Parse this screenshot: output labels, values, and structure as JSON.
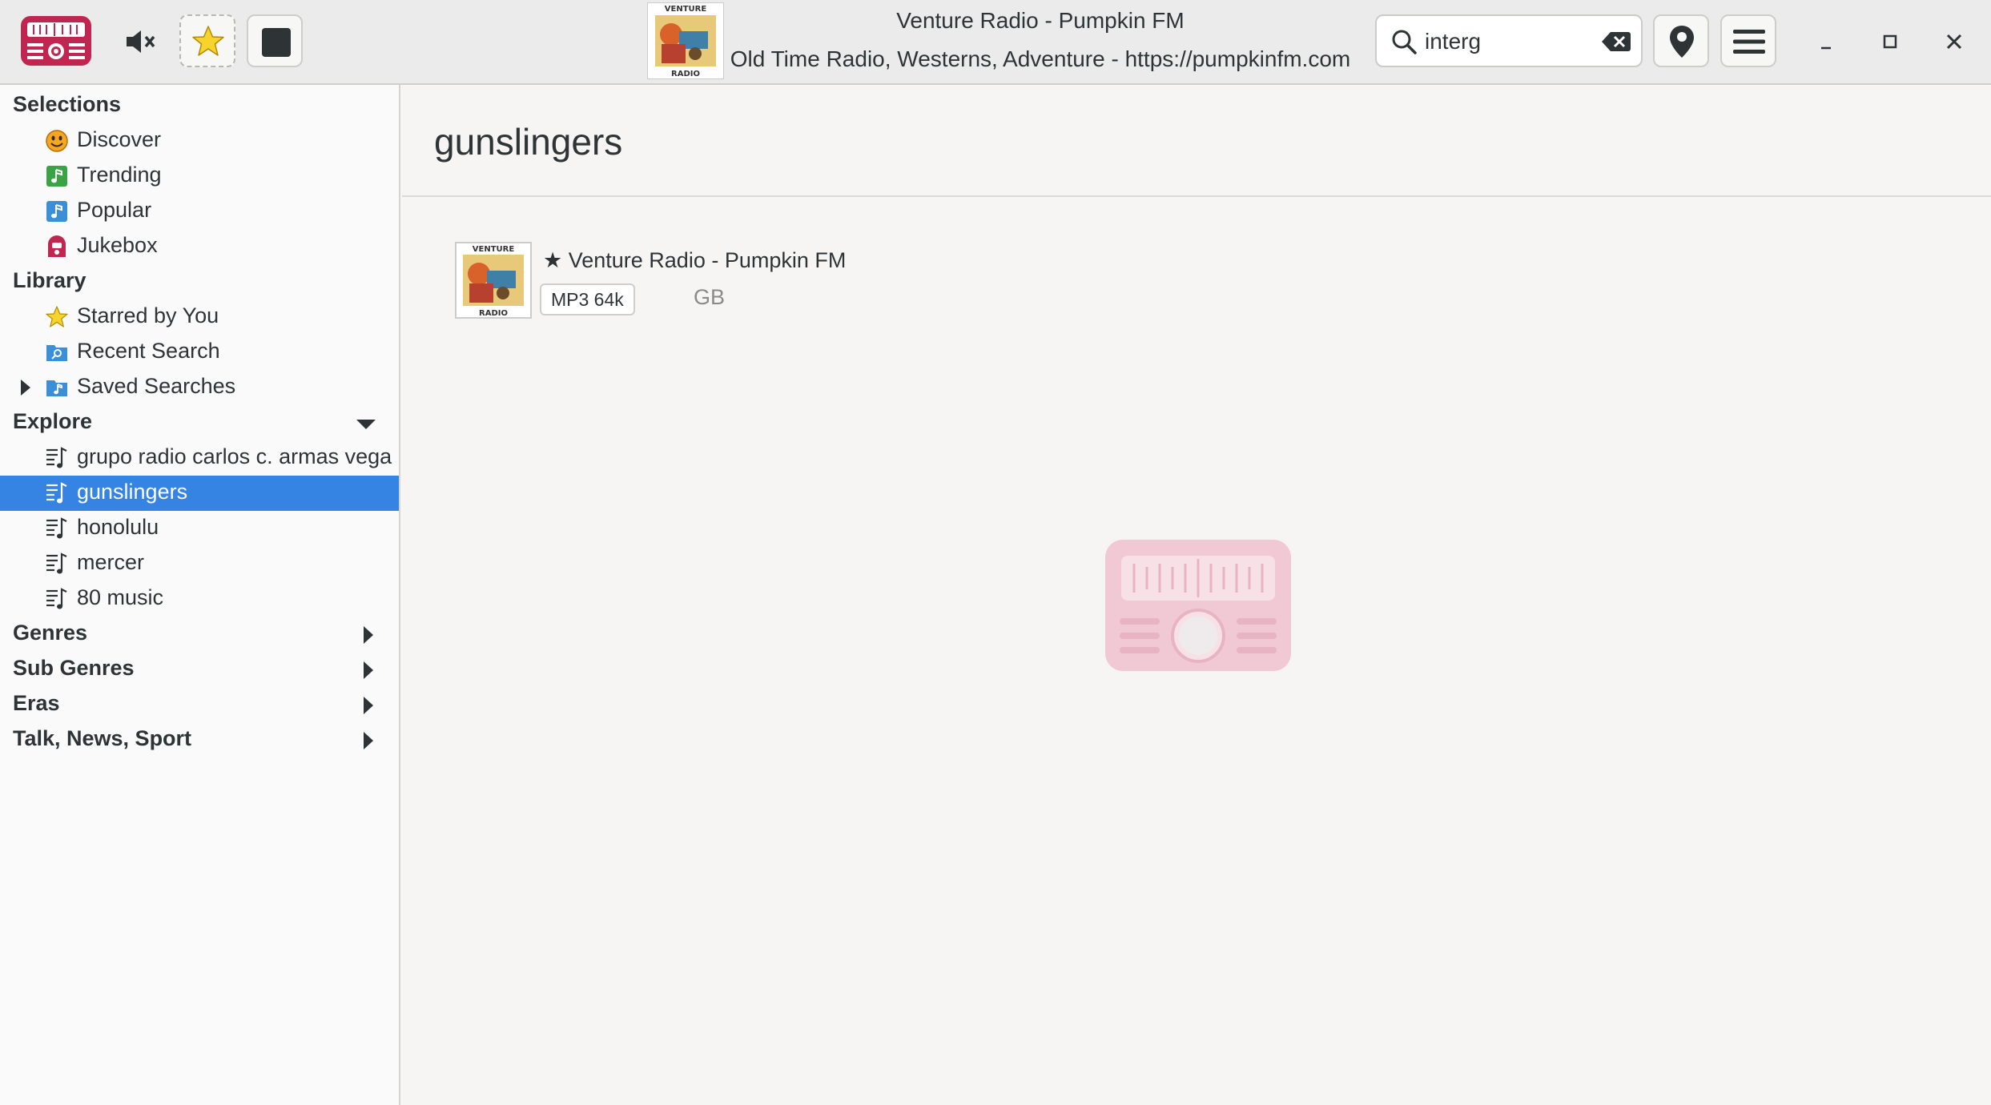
{
  "header": {
    "now_playing_title": "Venture Radio - Pumpkin FM",
    "now_playing_subtitle": "Old Time Radio, Westerns, Adventure - https://pumpkinfm.com",
    "thumb_text_top": "VENTURE",
    "thumb_text_bottom": "RADIO",
    "search_value": "interg",
    "icons": [
      "app-logo-icon",
      "mute-icon",
      "star-icon",
      "stop-icon",
      "search-icon",
      "clear-icon",
      "location-icon",
      "menu-icon",
      "minimize-icon",
      "maximize-icon",
      "close-icon"
    ]
  },
  "sidebar": {
    "selections": {
      "label": "Selections",
      "items": [
        {
          "label": "Discover",
          "icon": "smiley-icon"
        },
        {
          "label": "Trending",
          "icon": "trending-icon"
        },
        {
          "label": "Popular",
          "icon": "popular-icon"
        },
        {
          "label": "Jukebox",
          "icon": "jukebox-icon"
        }
      ]
    },
    "library": {
      "label": "Library",
      "items": [
        {
          "label": "Starred by You",
          "icon": "star-icon"
        },
        {
          "label": "Recent Search",
          "icon": "recent-search-icon"
        },
        {
          "label": "Saved Searches",
          "icon": "saved-searches-icon"
        }
      ]
    },
    "explore": {
      "label": "Explore",
      "items": [
        {
          "label": "grupo radio carlos c. armas vega",
          "icon": "playlist-icon"
        },
        {
          "label": "gunslingers",
          "icon": "playlist-icon",
          "selected": true
        },
        {
          "label": "honolulu",
          "icon": "playlist-icon"
        },
        {
          "label": "mercer",
          "icon": "playlist-icon"
        },
        {
          "label": "80 music",
          "icon": "playlist-icon"
        }
      ]
    },
    "genres": "Genres",
    "sub_genres": "Sub Genres",
    "eras": "Eras",
    "talk": "Talk, News, Sport"
  },
  "main": {
    "title": "gunslingers",
    "stations": [
      {
        "name": "★ Venture Radio - Pumpkin FM",
        "codec": "MP3 64k",
        "country": "GB"
      }
    ]
  },
  "colors": {
    "accent": "#3584e4",
    "brand": "#c0264f",
    "watermark": "#f0c9d4"
  }
}
